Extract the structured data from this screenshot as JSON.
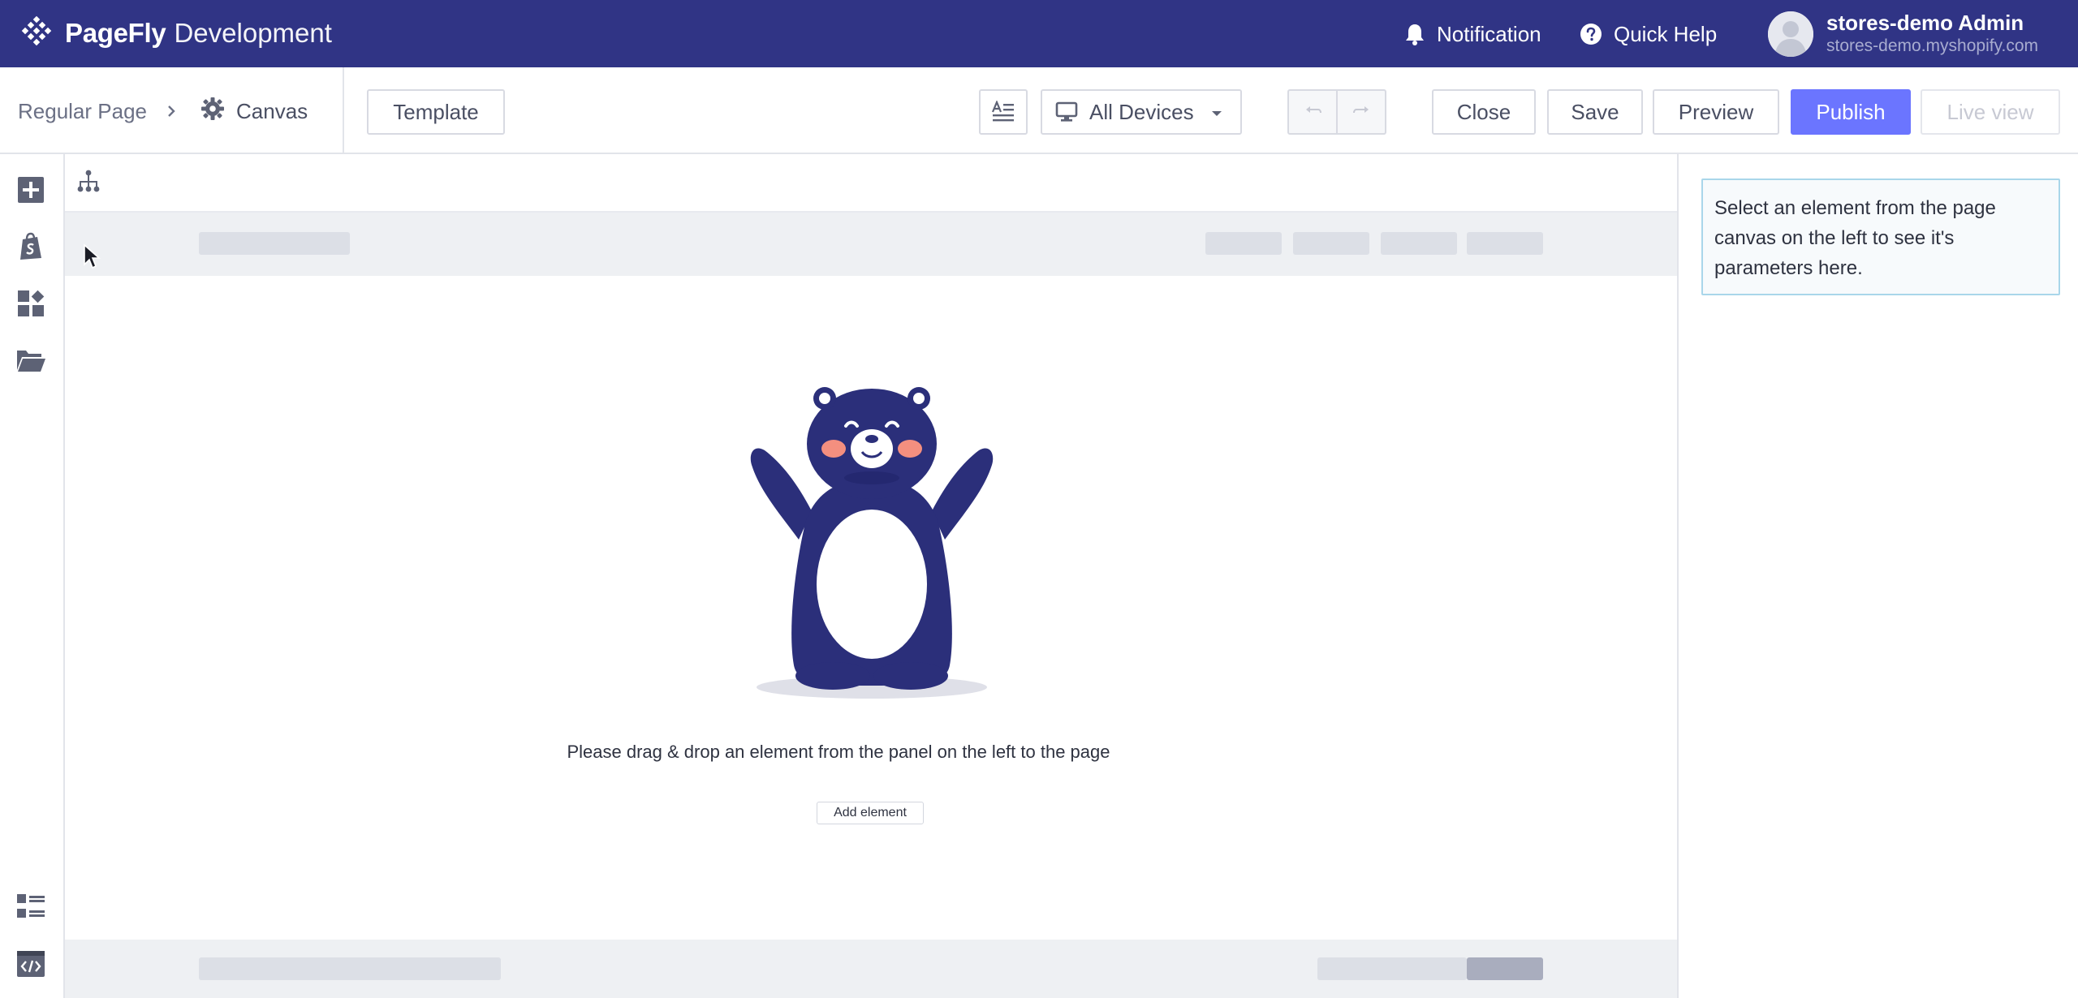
{
  "topbar": {
    "brand_name": "PageFly",
    "brand_sub": "Development",
    "notification_label": "Notification",
    "help_label": "Quick Help",
    "user_name": "stores-demo Admin",
    "user_store": "stores-demo.myshopify.com"
  },
  "toolbar": {
    "breadcrumb_root": "Regular Page",
    "breadcrumb_current": "Canvas",
    "template_label": "Template",
    "devices_label": "All Devices",
    "close_label": "Close",
    "save_label": "Save",
    "preview_label": "Preview",
    "publish_label": "Publish",
    "live_view_label": "Live view"
  },
  "sidebar": {
    "icons": [
      "add-element-icon",
      "shopify-icon",
      "widgets-icon",
      "folder-icon",
      "layers-list-icon",
      "code-icon"
    ]
  },
  "canvas": {
    "empty_message": "Please drag & drop an element from the panel on the left to the page",
    "add_element_label": "Add element"
  },
  "right_panel": {
    "hint": "Select an element from the page canvas on the left to see it's parameters here."
  },
  "colors": {
    "topbar": "#303485",
    "accent": "#6b75ff",
    "bear": "#2b2f7a",
    "cheeks": "#f48f7f"
  }
}
